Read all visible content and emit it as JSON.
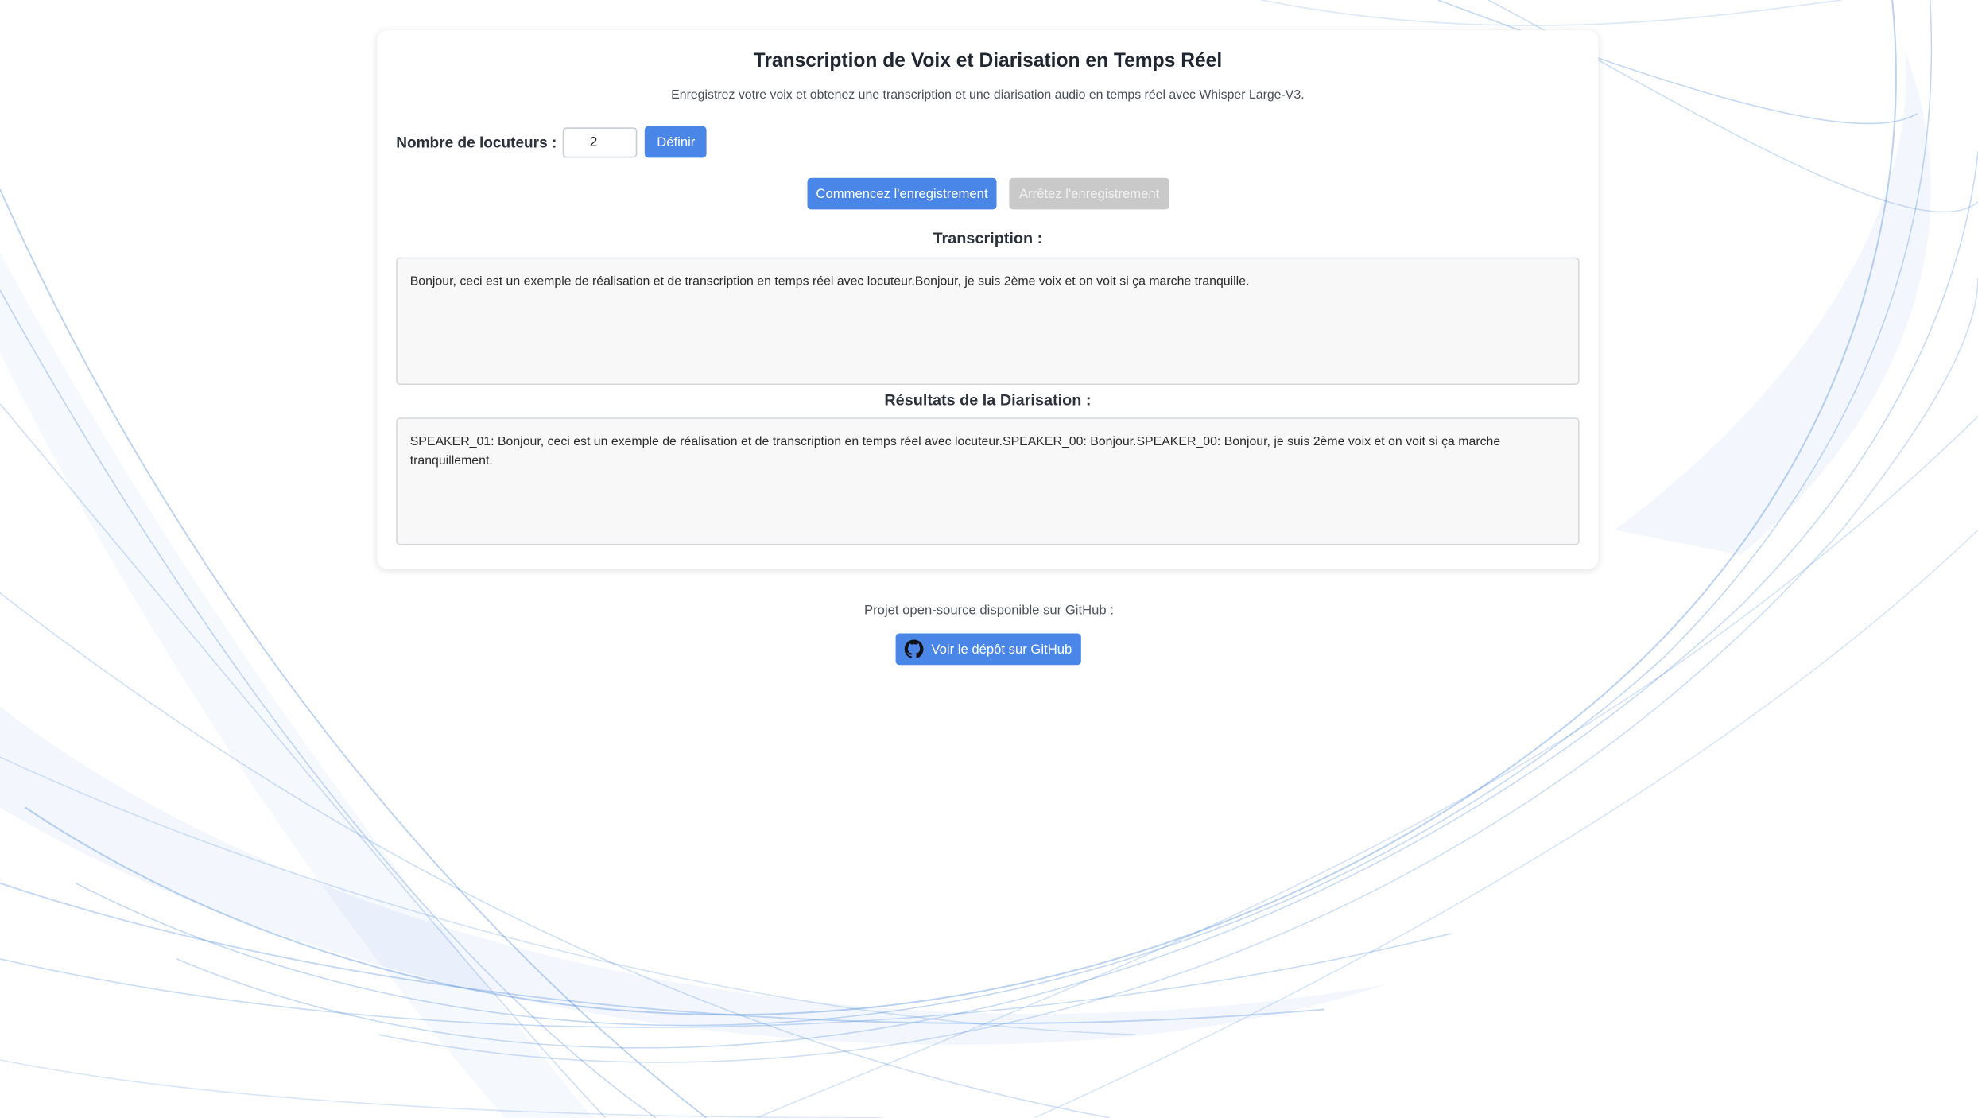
{
  "header": {
    "title": "Transcription de Voix et Diarisation en Temps Réel",
    "subtitle": "Enregistrez votre voix et obtenez une transcription et une diarisation audio en temps réel avec Whisper Large-V3."
  },
  "speakers": {
    "label": "Nombre de locuteurs :",
    "value": "2",
    "define_label": "Définir"
  },
  "recording": {
    "start_label": "Commencez l'enregistrement",
    "stop_label": "Arrêtez l'enregistrement",
    "stop_disabled": true
  },
  "transcription": {
    "heading": "Transcription :",
    "text": "Bonjour, ceci est un exemple de réalisation et de transcription en temps réel avec locuteur.Bonjour, je suis 2ème voix et on voit si ça marche tranquille."
  },
  "diarization": {
    "heading": "Résultats de la Diarisation :",
    "text": "SPEAKER_01: Bonjour, ceci est un exemple de réalisation et de transcription en temps réel avec locuteur.SPEAKER_00: Bonjour.SPEAKER_00: Bonjour, je suis 2ème voix et on voit si ça marche tranquillement."
  },
  "footer": {
    "text": "Projet open-source disponible sur GitHub :",
    "github_label": "Voir le dépôt sur GitHub",
    "github_icon": "github-icon"
  },
  "colors": {
    "primary": "#4a86e8",
    "disabled": "#c9c9c9",
    "background_wave": "#3b7dd8"
  }
}
